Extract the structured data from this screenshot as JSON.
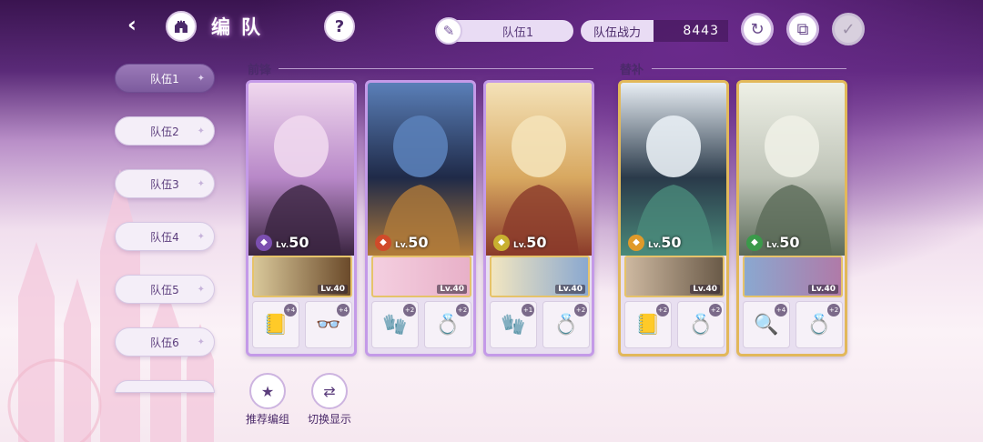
{
  "header": {
    "title": "编队",
    "back_icon": "back-arrow-icon",
    "home_icon": "castle-home-icon",
    "help_label": "?",
    "team_name": "队伍1",
    "power_label": "队伍战力",
    "power_value": "8443"
  },
  "sidebar": {
    "tabs": [
      {
        "label": "队伍1",
        "active": true
      },
      {
        "label": "队伍2",
        "active": false
      },
      {
        "label": "队伍3",
        "active": false
      },
      {
        "label": "队伍4",
        "active": false
      },
      {
        "label": "队伍5",
        "active": false
      },
      {
        "label": "队伍6",
        "active": false
      }
    ]
  },
  "sections": {
    "front": "前锋",
    "sub": "替补"
  },
  "cards": [
    {
      "group": "front",
      "lv_prefix": "Lv.",
      "level": "50",
      "element_color": "#7b4fb0",
      "sub_level": "Lv.40",
      "portrait_colors": [
        "#f0d8ee",
        "#b888c8",
        "#3a2440"
      ],
      "sub_colors": [
        "#d9c89a",
        "#6b4a2a"
      ],
      "gear": [
        {
          "icon": "book-icon",
          "badge": "+4"
        },
        {
          "icon": "glasses-icon",
          "badge": "+4"
        }
      ]
    },
    {
      "group": "front",
      "lv_prefix": "Lv.",
      "level": "50",
      "element_color": "#d04a2a",
      "sub_level": "Lv.40",
      "portrait_colors": [
        "#5a7fb8",
        "#1f2a48",
        "#b07a3a"
      ],
      "sub_colors": [
        "#f4cfe0",
        "#e8b0c8"
      ],
      "gear": [
        {
          "icon": "glove-icon",
          "badge": "+2"
        },
        {
          "icon": "ring-icon",
          "badge": "+2"
        }
      ]
    },
    {
      "group": "front",
      "lv_prefix": "Lv.",
      "level": "50",
      "element_color": "#c8b030",
      "sub_level": "Lv.40",
      "portrait_colors": [
        "#f4e2b8",
        "#d8a860",
        "#8a3a2a"
      ],
      "sub_colors": [
        "#f2e6c0",
        "#8aa8d0"
      ],
      "gear": [
        {
          "icon": "glove-icon",
          "badge": "+1"
        },
        {
          "icon": "ring-icon",
          "badge": "+2"
        }
      ]
    },
    {
      "group": "sub",
      "lv_prefix": "Lv.",
      "level": "50",
      "element_color": "#e09a2a",
      "sub_level": "Lv.40",
      "portrait_colors": [
        "#e8eef4",
        "#2a3a4a",
        "#4a8a7a"
      ],
      "sub_colors": [
        "#cdb8a0",
        "#6a5a48"
      ],
      "gear": [
        {
          "icon": "book-icon",
          "badge": "+2"
        },
        {
          "icon": "ring-icon",
          "badge": "+2"
        }
      ]
    },
    {
      "group": "sub",
      "lv_prefix": "Lv.",
      "level": "50",
      "element_color": "#3a9a4a",
      "sub_level": "Lv.40",
      "portrait_colors": [
        "#eef0e6",
        "#bfc4b8",
        "#5a6a58"
      ],
      "sub_colors": [
        "#8aa8d0",
        "#b07aa8"
      ],
      "gear": [
        {
          "icon": "magnifier-icon",
          "badge": "+4"
        },
        {
          "icon": "ring-icon",
          "badge": "+2"
        }
      ]
    }
  ],
  "bottom": {
    "recommend_label": "推荐编组",
    "switch_label": "切换显示"
  }
}
